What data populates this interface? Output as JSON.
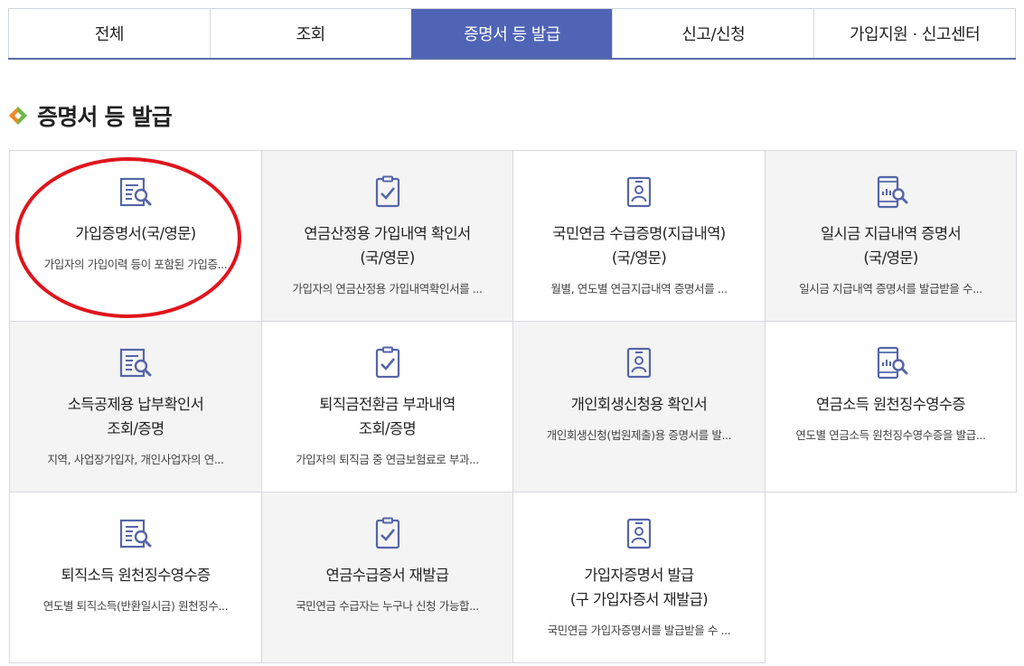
{
  "tabs": [
    {
      "label": "전체",
      "active": false
    },
    {
      "label": "조회",
      "active": false
    },
    {
      "label": "증명서 등 발급",
      "active": true
    },
    {
      "label": "신고/신청",
      "active": false
    },
    {
      "label": "가입지원 · 신고센터",
      "active": false
    }
  ],
  "section": {
    "title": "증명서 등 발급"
  },
  "colors": {
    "accent": "#5064b6",
    "icon": "#5565a8",
    "highlight_circle": "#e0141c",
    "diamond_orange": "#f08a24",
    "diamond_green": "#69b944"
  },
  "cards": [
    {
      "icon": "document-search-icon",
      "title1": "가입증명서(국/영문)",
      "title2": "",
      "desc": "가입자의 가입이력 등이 포함된 가입증..."
    },
    {
      "icon": "clipboard-check-icon",
      "title1": "연금산정용 가입내역 확인서",
      "title2": "(국/영문)",
      "desc": "가입자의 연금산정용 가입내역확인서를 ..."
    },
    {
      "icon": "id-badge-icon",
      "title1": "국민연금 수급증명(지급내역)",
      "title2": "(국/영문)",
      "desc": "월별, 연도별 연금지급내역 증명서를 ..."
    },
    {
      "icon": "mobile-chart-search-icon",
      "title1": "일시금 지급내역 증명서",
      "title2": "(국/영문)",
      "desc": "일시금 지급내역 증명서를 발급받을 수..."
    },
    {
      "icon": "document-search-icon",
      "title1": "소득공제용 납부확인서",
      "title2": "조회/증명",
      "desc": "지역, 사업장가입자, 개인사업자의 연..."
    },
    {
      "icon": "clipboard-check-icon",
      "title1": "퇴직금전환금 부과내역",
      "title2": "조회/증명",
      "desc": "가입자의 퇴직금 중 연금보험료로 부과..."
    },
    {
      "icon": "id-badge-icon",
      "title1": "개인회생신청용 확인서",
      "title2": "",
      "desc": "개인회생신청(법원제출)용 증명서를 발..."
    },
    {
      "icon": "mobile-chart-search-icon",
      "title1": "연금소득 원천징수영수증",
      "title2": "",
      "desc": "연도별 연금소득 원천징수영수증을 발급..."
    },
    {
      "icon": "document-search-icon",
      "title1": "퇴직소득 원천징수영수증",
      "title2": "",
      "desc": "연도별 퇴직소득(반환일시금) 원천징수..."
    },
    {
      "icon": "clipboard-check-icon",
      "title1": "연금수급증서 재발급",
      "title2": "",
      "desc": "국민연금 수급자는 누구나 신청 가능합..."
    },
    {
      "icon": "id-badge-icon",
      "title1": "가입자증명서 발급",
      "title2": "(구 가입자증서 재발급)",
      "desc": "국민연금 가입자증명서를 발급받을 수 ..."
    }
  ]
}
